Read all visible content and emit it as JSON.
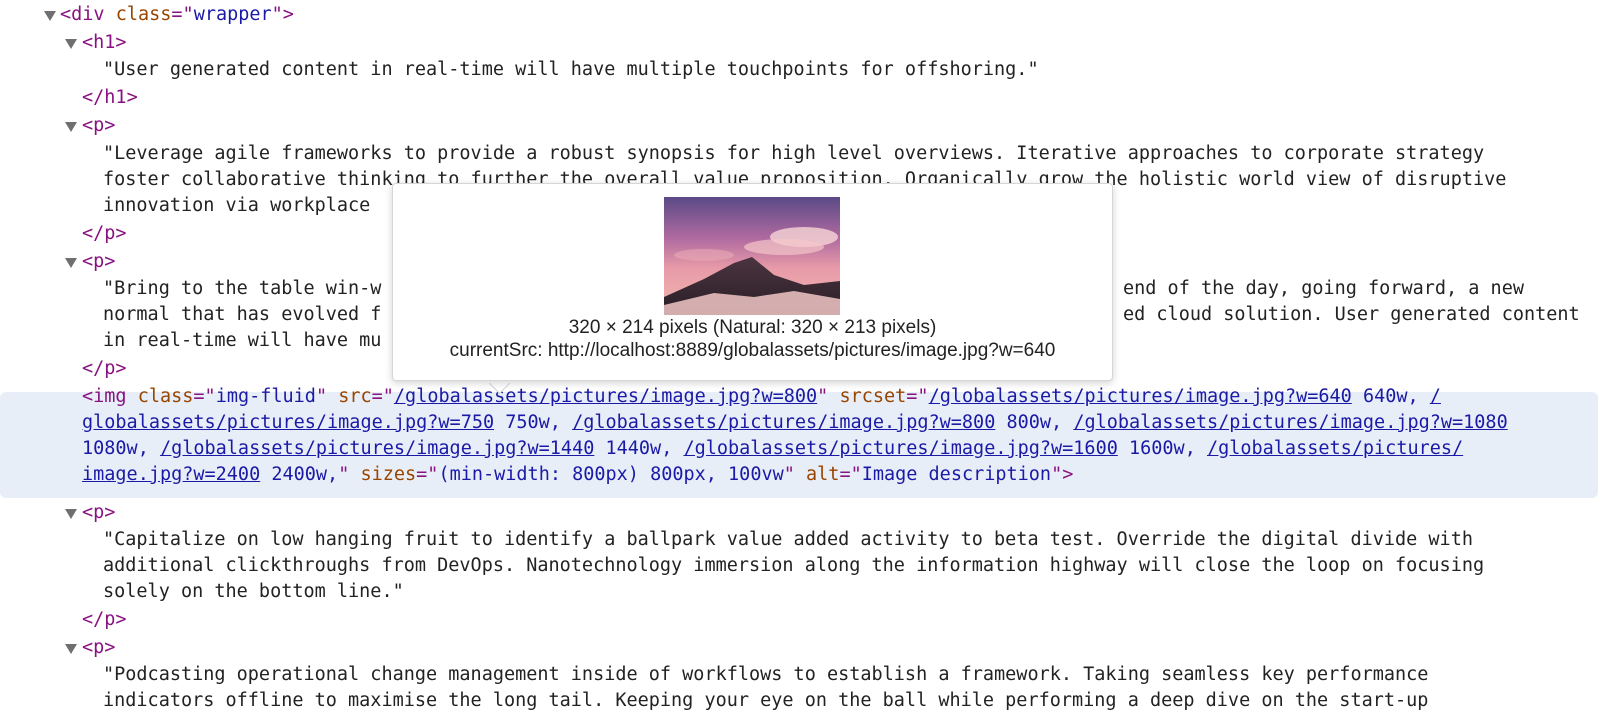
{
  "tree": {
    "wrapper_open": {
      "tag": "div",
      "attr": "class",
      "value": "wrapper"
    },
    "h1_open": "h1",
    "h1_text": "\"User generated content in real-time will have multiple touchpoints for offshoring.\"",
    "h1_close": "/h1",
    "p1_text": [
      "\"Leverage agile frameworks to provide a robust synopsis for high level overviews. Iterative approaches to corporate strategy",
      "foster collaborative thinking to further the overall value proposition. Organically grow the holistic world view of disruptive",
      "innovation via workplace"
    ],
    "p2_text": [
      "\"Bring to the table win-w",
      "end of the day, going forward, a new",
      "normal that has evolved f",
      "ed cloud solution. User generated content",
      "in real-time will have mu"
    ],
    "p3_text": [
      "\"Capitalize on low hanging fruit to identify a ballpark value added activity to beta test. Override the digital divide with",
      "additional clickthroughs from DevOps. Nanotechnology immersion along the information highway will close the loop on focusing",
      "solely on the bottom line.\""
    ],
    "p4_text": [
      "\"Podcasting operational change management inside of workflows to establish a framework. Taking seamless key performance",
      "indicators offline to maximise the long tail. Keeping your eye on the ball while performing a deep dive on the start-up"
    ],
    "p_open": "p",
    "p_close": "/p"
  },
  "img_node": {
    "tag": "img",
    "class_attr": "class",
    "class_val": "img-fluid",
    "src_attr": "src",
    "src_val": "/globalassets/pictures/image.jpg?w=800",
    "srcset_attr": "srcset",
    "srcset_links": [
      "/globalassets/pictures/image.jpg?w=640",
      "/",
      "globalassets/pictures/image.jpg?w=750",
      "/globalassets/pictures/image.jpg?w=800",
      "/globalassets/pictures/image.jpg?w=1080",
      "/globalassets/pictures/image.jpg?w=1440",
      "/globalassets/pictures/image.jpg?w=1600",
      "/globalassets/pictures/",
      "image.jpg?w=2400"
    ],
    "srcset_descriptors": [
      "640w,",
      "750w,",
      "800w,",
      "1080w,",
      "1440w,",
      "1600w,",
      "2400w,"
    ],
    "sizes_attr": "sizes",
    "sizes_val": "(min-width: 800px) 800px, 100vw",
    "alt_attr": "alt",
    "alt_val": "Image description"
  },
  "tooltip": {
    "dimensions": "320 × 214 pixels (Natural: 320 × 213 pixels)",
    "current_src": "currentSrc: http://localhost:8889/globalassets/pictures/image.jpg?w=640"
  },
  "icons": {
    "expand": "disclosure-triangle-expanded"
  }
}
